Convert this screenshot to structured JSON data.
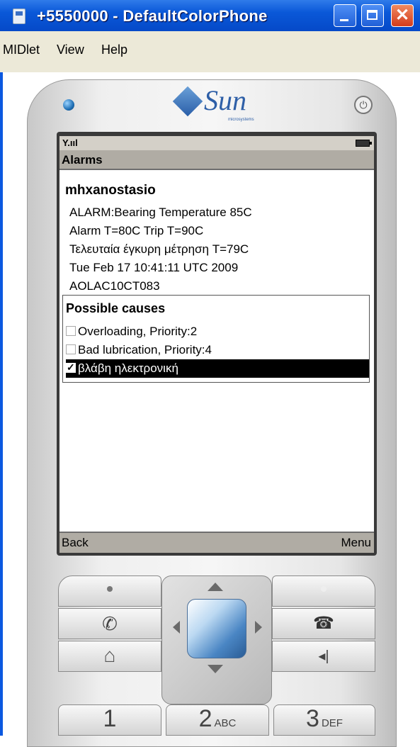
{
  "window": {
    "title": "+5550000 - DefaultColorPhone",
    "close_glyph": "✕"
  },
  "menubar": {
    "items": [
      "MIDlet",
      "View",
      "Help"
    ]
  },
  "phone": {
    "brand": "Sun",
    "brand_sub": "microsystems",
    "signal": "Y.ııl"
  },
  "screen": {
    "title": "Alarms",
    "device_name": "mhxanostasio",
    "lines": [
      "ALARM:Bearing Temperature 85C",
      "Alarm T=80C    Trip T=90C",
      "Τελευταία έγκυρη μέτρηση T=79C",
      "Tue Feb 17 10:41:11 UTC 2009",
      "AOLAC10CT083"
    ],
    "causes": {
      "title": "Possible causes",
      "options": [
        {
          "label": "Overloading, Priority:2",
          "checked": false,
          "selected": false
        },
        {
          "label": "Bad lubrication, Priority:4",
          "checked": false,
          "selected": false
        },
        {
          "label": "βλάβη ηλεκτρονική",
          "checked": true,
          "selected": true
        }
      ]
    },
    "softkeys": {
      "left": "Back",
      "right": "Menu"
    }
  },
  "keypad": {
    "keys": [
      {
        "num": "1",
        "sub": ""
      },
      {
        "num": "2",
        "sub": "ABC"
      },
      {
        "num": "3",
        "sub": "DEF"
      }
    ],
    "icons": {
      "call": "✆",
      "home": "⌂",
      "back": "◂|",
      "end": "☎"
    }
  }
}
